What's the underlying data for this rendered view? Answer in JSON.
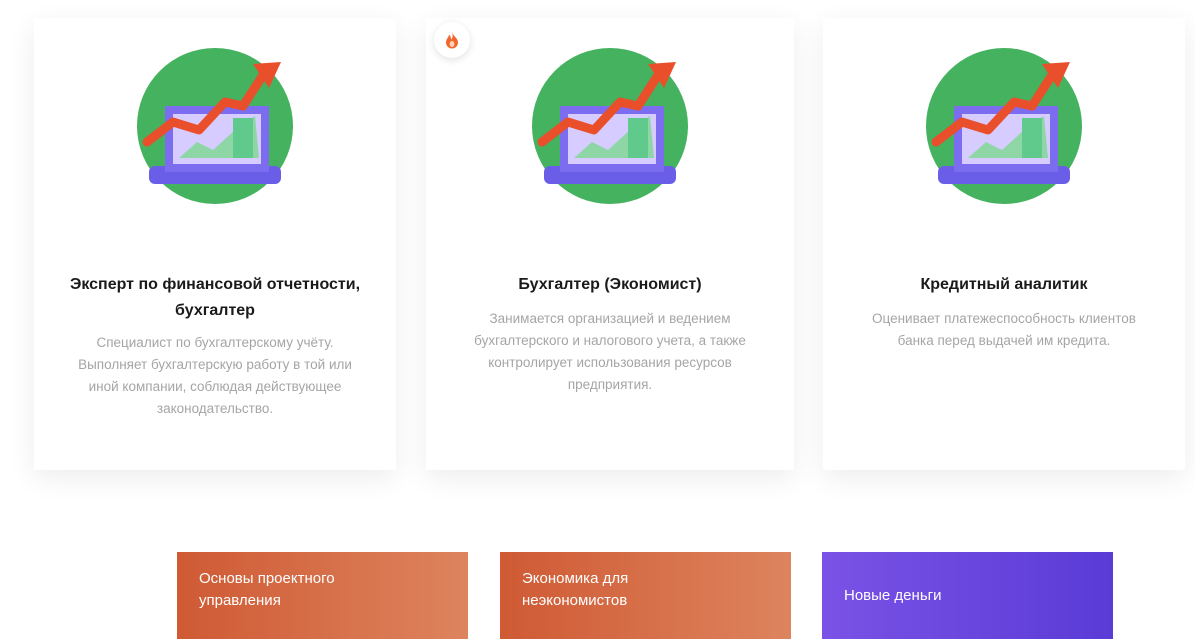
{
  "colors": {
    "card_title": "#1a1a1a",
    "card_text": "#a5a5a5",
    "illustration_circle": "#44b25e",
    "arrow": "#e94f2b",
    "laptop": "#6a5de8",
    "course_orange": "#d2633d",
    "course_purple": "#6a47e0"
  },
  "professions": [
    {
      "title": "Эксперт по финансовой отчетности, бухгалтер",
      "description": "Специалист по бухгалтерскому учёту. Выполняет бухгалтерскую работу в той или иной компании, соблюдая действующее законодательство.",
      "icon": "growth-chart-laptop-icon",
      "hot": false
    },
    {
      "title": "Бухгалтер (Экономист)",
      "description": "Занимается организацией и ведением бухгалтерского и налогового учета, а также контролирует использования ресурсов предприятия.",
      "icon": "growth-chart-laptop-icon",
      "hot": true,
      "badge_icon": "fire-icon"
    },
    {
      "title": "Кредитный аналитик",
      "description": "Оценивает платежеспособность клиентов банка перед выдачей им кредита.",
      "icon": "growth-chart-laptop-icon",
      "hot": false
    }
  ],
  "courses": [
    {
      "label": "Основы проектного\nуправления"
    },
    {
      "label": "Экономика для\nнеэкономистов"
    },
    {
      "label": "Новые деньги"
    }
  ]
}
